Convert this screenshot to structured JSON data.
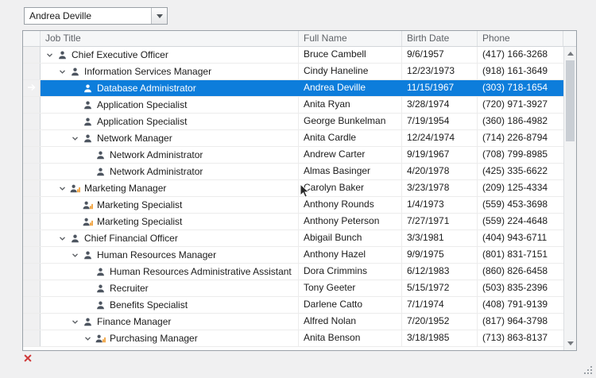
{
  "combo": {
    "value": "Andrea Deville"
  },
  "grid": {
    "columns": [
      {
        "label": "Job Title"
      },
      {
        "label": "Full Name"
      },
      {
        "label": "Birth Date"
      },
      {
        "label": "Phone"
      }
    ],
    "rows": [
      {
        "level": 0,
        "expanded": true,
        "icon": "person",
        "selected": false,
        "job": "Chief Executive Officer",
        "name": "Bruce Cambell",
        "birth": "9/6/1957",
        "phone": "(417) 166-3268"
      },
      {
        "level": 1,
        "expanded": true,
        "icon": "person",
        "selected": false,
        "job": "Information Services Manager",
        "name": "Cindy Haneline",
        "birth": "12/23/1973",
        "phone": "(918) 161-3649"
      },
      {
        "level": 2,
        "expanded": false,
        "icon": "person",
        "selected": true,
        "job": "Database Administrator",
        "name": "Andrea Deville",
        "birth": "11/15/1967",
        "phone": "(303) 718-1654"
      },
      {
        "level": 2,
        "expanded": false,
        "icon": "person",
        "selected": false,
        "job": "Application Specialist",
        "name": "Anita Ryan",
        "birth": "3/28/1974",
        "phone": "(720) 971-3927"
      },
      {
        "level": 2,
        "expanded": false,
        "icon": "person",
        "selected": false,
        "job": "Application Specialist",
        "name": "George Bunkelman",
        "birth": "7/19/1954",
        "phone": "(360) 186-4982"
      },
      {
        "level": 2,
        "expanded": true,
        "icon": "person",
        "selected": false,
        "job": "Network Manager",
        "name": "Anita Cardle",
        "birth": "12/24/1974",
        "phone": "(714) 226-8794"
      },
      {
        "level": 3,
        "expanded": false,
        "icon": "person",
        "selected": false,
        "job": "Network Administrator",
        "name": "Andrew Carter",
        "birth": "9/19/1967",
        "phone": "(708) 799-8985"
      },
      {
        "level": 3,
        "expanded": false,
        "icon": "person",
        "selected": false,
        "job": "Network Administrator",
        "name": "Almas Basinger",
        "birth": "4/20/1978",
        "phone": "(425) 335-6622"
      },
      {
        "level": 1,
        "expanded": true,
        "icon": "person-orange",
        "selected": false,
        "job": "Marketing Manager",
        "name": "Carolyn Baker",
        "birth": "3/23/1978",
        "phone": "(209) 125-4334"
      },
      {
        "level": 2,
        "expanded": false,
        "icon": "person-orange",
        "selected": false,
        "job": "Marketing Specialist",
        "name": "Anthony Rounds",
        "birth": "1/4/1973",
        "phone": "(559) 453-3698"
      },
      {
        "level": 2,
        "expanded": false,
        "icon": "person-orange",
        "selected": false,
        "job": "Marketing Specialist",
        "name": "Anthony Peterson",
        "birth": "7/27/1971",
        "phone": "(559) 224-4648"
      },
      {
        "level": 1,
        "expanded": true,
        "icon": "person",
        "selected": false,
        "job": "Chief Financial Officer",
        "name": "Abigail Bunch",
        "birth": "3/3/1981",
        "phone": "(404) 943-6711"
      },
      {
        "level": 2,
        "expanded": true,
        "icon": "person",
        "selected": false,
        "job": "Human Resources Manager",
        "name": "Anthony Hazel",
        "birth": "9/9/1975",
        "phone": "(801) 831-7151"
      },
      {
        "level": 3,
        "expanded": false,
        "icon": "person",
        "selected": false,
        "job": "Human Resources Administrative Assistant",
        "name": "Dora Crimmins",
        "birth": "6/12/1983",
        "phone": "(860) 826-6458"
      },
      {
        "level": 3,
        "expanded": false,
        "icon": "person",
        "selected": false,
        "job": "Recruiter",
        "name": "Tony Geeter",
        "birth": "5/15/1972",
        "phone": "(503) 835-2396"
      },
      {
        "level": 3,
        "expanded": false,
        "icon": "person",
        "selected": false,
        "job": "Benefits Specialist",
        "name": "Darlene Catto",
        "birth": "7/1/1974",
        "phone": "(408) 791-9139"
      },
      {
        "level": 2,
        "expanded": true,
        "icon": "person",
        "selected": false,
        "job": "Finance Manager",
        "name": "Alfred Nolan",
        "birth": "7/20/1952",
        "phone": "(817) 964-3798"
      },
      {
        "level": 3,
        "expanded": true,
        "icon": "person-orange",
        "selected": false,
        "job": "Purchasing Manager",
        "name": "Anita Benson",
        "birth": "3/18/1985",
        "phone": "(713) 863-8137"
      }
    ]
  },
  "colors": {
    "selection": "#0d7ddb",
    "icon_orange": "#f0a13c",
    "error": "#cf3a3a"
  }
}
